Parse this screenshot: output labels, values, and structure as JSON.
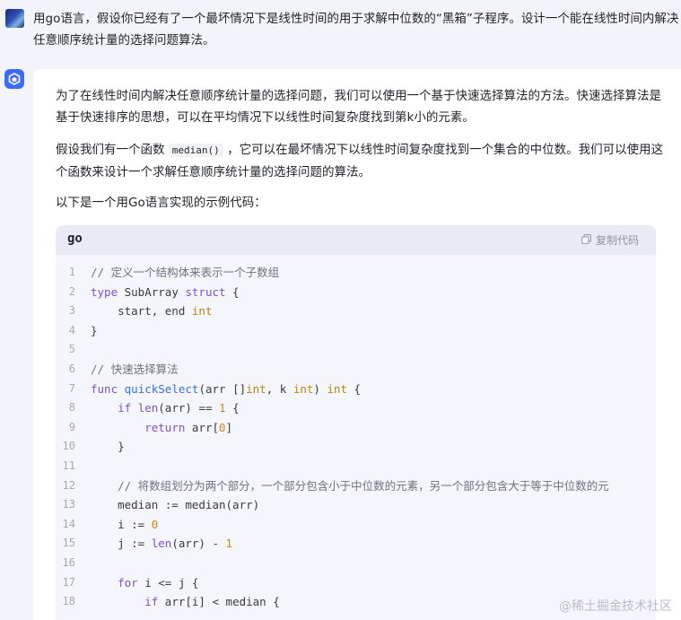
{
  "user": {
    "message": "用go语言，假设你已经有了一个最坏情况下是线性时间的用于求解中位数的“黑箱”子程序。设计一个能在线性时间内解决任意顺序统计量的选择问题算法。"
  },
  "answer": {
    "para1": "为了在线性时间内解决任意顺序统计量的选择问题，我们可以使用一个基于快速选择算法的方法。快速选择算法是基于快速排序的思想，可以在平均情况下以线性时间复杂度找到第k小的元素。",
    "para2_before": "假设我们有一个函数 ",
    "para2_code": "median()",
    "para2_after": " ，它可以在最坏情况下以线性时间复杂度找到一个集合的中位数。我们可以使用这个函数来设计一个求解任意顺序统计量的选择问题的算法。",
    "para3": "以下是一个用Go语言实现的示例代码："
  },
  "code_block": {
    "language": "go",
    "copy_label": "复制代码",
    "copy_icon": "copy-icon",
    "line_numbers": [
      "1",
      "2",
      "3",
      "4",
      "5",
      "6",
      "7",
      "8",
      "9",
      "10",
      "11",
      "12",
      "13",
      "14",
      "15",
      "16",
      "17",
      "18"
    ]
  },
  "watermark": "@稀土掘金技术社区",
  "colors": {
    "background": "#f3f4f9",
    "card": "#ffffff",
    "code_bg": "#f5f6fb",
    "code_header": "#e8eaf6",
    "bot_avatar": "#3b6cf6",
    "keyword": "#8050c8",
    "function": "#3a6fd8",
    "number": "#c98a14"
  }
}
